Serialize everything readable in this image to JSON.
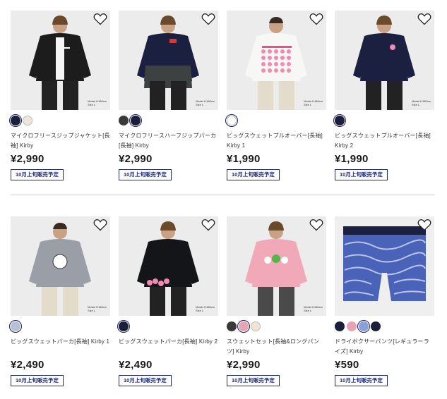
{
  "products": [
    {
      "name": "マイクロフリースジップジャケット[長袖] Kirby",
      "price": "¥2,990",
      "badge": "10月上旬販売予定",
      "model_note": [
        "Model H180cm",
        "Size L"
      ],
      "colors": [
        "#1b1f3b",
        "#efe6d6"
      ],
      "garment": "#1c1c1c",
      "accent": "#1c1c1c",
      "inner": "#f5f5f5",
      "bg": "#ececec"
    },
    {
      "name": "マイクロフリースハーフジップパーカ[長袖] Kirby",
      "price": "¥2,990",
      "badge": "10月上旬販売予定",
      "model_note": [
        "Model H180cm",
        "Size L"
      ],
      "colors": [
        "#3a3a3a",
        "#1b1f3b"
      ],
      "garment": "#1b2040",
      "accent": "#3e4142",
      "inner": "#1b2040",
      "bg": "#ececec"
    },
    {
      "name": "ビッグスウェットプルオーバー[長袖] Kirby 1",
      "price": "¥1,990",
      "badge": "10月上旬販売予定",
      "model_note": [
        "Model H180cm",
        "Size L"
      ],
      "colors": [
        "#ffffff"
      ],
      "garment": "#f7f7f5",
      "accent": "#f7f7f5",
      "inner": "#f7f7f5",
      "bg": "#ececec"
    },
    {
      "name": "ビッグスウェットプルオーバー[長袖] Kirby 2",
      "price": "¥1,990",
      "badge": "10月上旬販売予定",
      "model_note": [
        "Model H180cm",
        "Size L"
      ],
      "colors": [
        "#1b1f3b"
      ],
      "garment": "#1b2040",
      "accent": "#1b2040",
      "inner": "#1b2040",
      "bg": "#ececec"
    },
    {
      "name": "ビッグスウェットパーカ[長袖] Kirby 1",
      "price": "¥2,490",
      "badge": "10月上旬販売予定",
      "model_note": [
        "Model H180cm",
        "Size L"
      ],
      "colors": [
        "#b8c0d4"
      ],
      "garment": "#9a9ea6",
      "accent": "#9a9ea6",
      "inner": "#9a9ea6",
      "bg": "#ececec"
    },
    {
      "name": "ビッグスウェットパーカ[長袖] Kirby 2",
      "price": "¥2,490",
      "badge": "10月上旬販売予定",
      "model_note": [
        "Model H180cm",
        "Size L"
      ],
      "colors": [
        "#1b1f3b"
      ],
      "garment": "#141518",
      "accent": "#141518",
      "inner": "#141518",
      "bg": "#ececec"
    },
    {
      "name": "スウェットセット[長袖&ロングパンツ] Kirby",
      "price": "¥2,990",
      "badge": "10月上旬販売予定",
      "model_note": [
        "Model H180cm",
        "Size L"
      ],
      "colors": [
        "#3a3a3a",
        "#e8a4b4",
        "#efe6d6"
      ],
      "garment": "#f1a9b9",
      "accent": "#4a4a4a",
      "inner": "#f1a9b9",
      "bg": "#ececec"
    },
    {
      "name": "ドライボクサーパンツ[レギュラーライズ] Kirby",
      "price": "¥590",
      "badge": "10月上旬販売予定",
      "model_note": [
        "",
        ""
      ],
      "colors": [
        "#1b1f3b",
        "#e8a4b4",
        "#8aa0d8",
        "#1b1f3b"
      ],
      "garment": "#4a63b8",
      "accent": "#1b2040",
      "inner": "#4a63b8",
      "bg": "#efefef"
    }
  ]
}
